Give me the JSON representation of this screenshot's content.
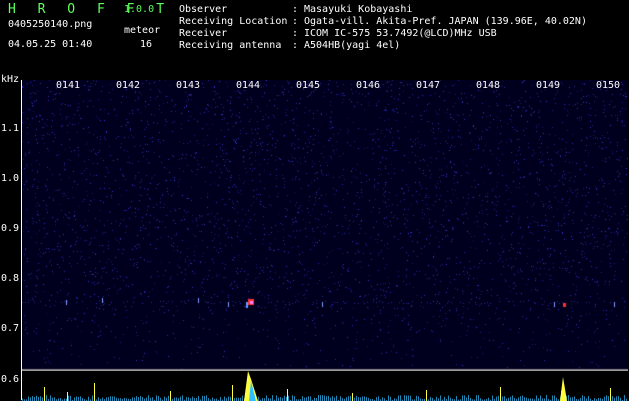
{
  "header": {
    "app_title": "H R O F F T",
    "app_version": "1.0.0",
    "file_name": "0405250140.png",
    "date_time": "04.05.25 01:40",
    "meteor_label": "meteor",
    "meteor_count": "16"
  },
  "info": [
    {
      "key": "Observer",
      "sep": ":",
      "value": "Masayuki Kobayashi"
    },
    {
      "key": "Receiving Location",
      "sep": ":",
      "value": "Ogata-vill. Akita-Pref. JAPAN (139.96E, 40.02N)"
    },
    {
      "key": "Receiver",
      "sep": ":",
      "value": "ICOM IC-575 53.7492(@LCD)MHz USB"
    },
    {
      "key": "Receiving antenna",
      "sep": ":",
      "value": "A504HB(yagi 4el)"
    }
  ],
  "axis": {
    "unit": "kHz",
    "time_labels": [
      "0141",
      "0142",
      "0143",
      "0144",
      "0145",
      "0146",
      "0147",
      "0148",
      "0149",
      "0150"
    ],
    "freq_labels": [
      "1.1",
      "1.0",
      "0.9",
      "0.8",
      "0.7",
      "0.6"
    ]
  },
  "colors": {
    "background": "#000000",
    "noise": "#1a1aa0",
    "meteor_echo": "#ff3030",
    "power_trace": "#ffff40",
    "power_fill": "#30c0ff",
    "header_green": "#5cff5c"
  }
}
